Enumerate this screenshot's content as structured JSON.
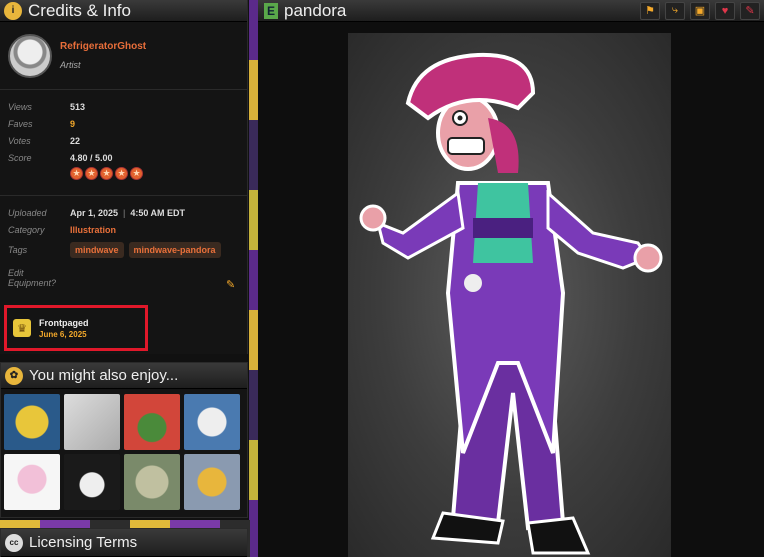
{
  "credits_panel": {
    "title": "Credits & Info",
    "artist": {
      "name": "RefrigeratorGhost",
      "role": "Artist"
    },
    "stats": [
      {
        "label": "Views",
        "value": "513"
      },
      {
        "label": "Faves",
        "value": "9"
      },
      {
        "label": "Votes",
        "value": "22"
      },
      {
        "label": "Score",
        "value": "4.80 / 5.00"
      }
    ],
    "rating_stars": 5,
    "uploaded": {
      "label": "Uploaded",
      "date": "Apr 1, 2025",
      "time": "4:50 AM EDT"
    },
    "category": {
      "label": "Category",
      "value": "Illustration"
    },
    "tags": {
      "label": "Tags",
      "items": [
        "mindwave",
        "mindwave-pandora"
      ]
    },
    "edit_equipment": "Edit Equipment?",
    "frontpaged": {
      "title": "Frontpaged",
      "date": "June 6, 2025"
    }
  },
  "enjoy_panel": {
    "title": "You might also enjoy...",
    "thumb_colors": [
      "#2a5a8a",
      "#cfcfcf",
      "#d2463a",
      "#4a7ab0",
      "#e8e8e8",
      "#1a1a1a",
      "#7a8a6a",
      "#8a9ab0"
    ]
  },
  "licensing_panel": {
    "title": "Licensing Terms"
  },
  "main": {
    "title": "pandora",
    "actions": [
      "flag-icon",
      "share-icon",
      "collection-icon",
      "heart-icon",
      "edit-icon"
    ]
  }
}
